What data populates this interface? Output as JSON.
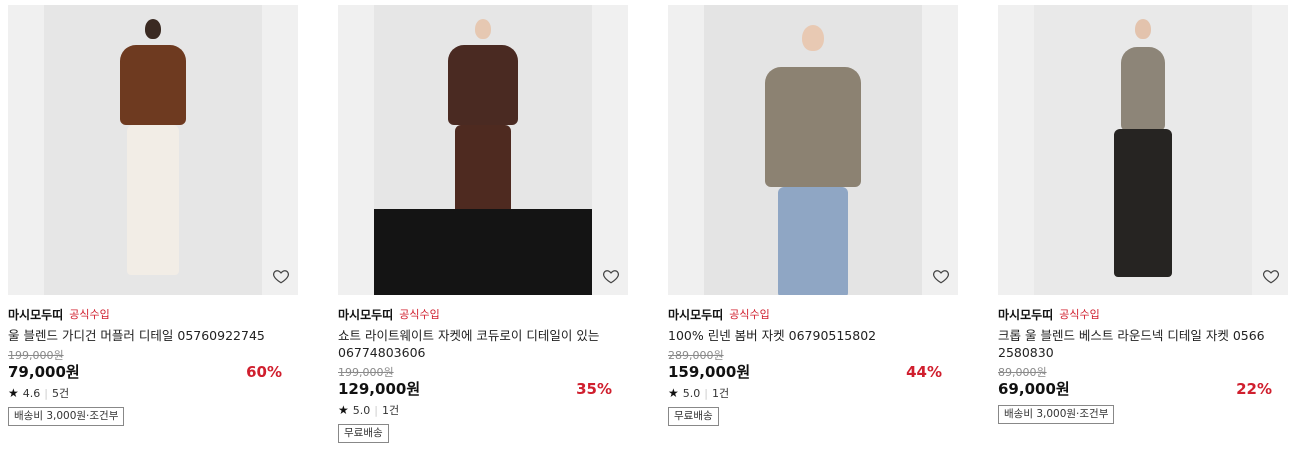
{
  "products": [
    {
      "brand": "마시모두띠",
      "badge": "공식수입",
      "title": "울 블렌드 가디건 머플러 디테일 05760922745",
      "original_price": "199,000원",
      "price": "79,000원",
      "discount": "60%",
      "rating": "4.6",
      "reviews": "5건",
      "shipping": "배송비 3,000원·조건부",
      "colors": {
        "bg": "#ebebeb",
        "top": "#6e3a20",
        "bottom": "#f2ede6",
        "skin": "#3a2a22"
      }
    },
    {
      "brand": "마시모두띠",
      "badge": "공식수입",
      "title": "쇼트 라이트웨이트 자켓에 코듀로이 디테일이 있는 06774803606",
      "original_price": "199,000원",
      "price": "129,000원",
      "discount": "35%",
      "rating": "5.0",
      "reviews": "1건",
      "shipping": "무료배송",
      "colors": {
        "bg": "#e6e6e6",
        "top": "#4a2a22",
        "bottom": "#4e2a20",
        "skin": "#e6c8b2"
      }
    },
    {
      "brand": "마시모두띠",
      "badge": "공식수입",
      "title": "100% 린넨 봄버 자켓 06790515802",
      "original_price": "289,000원",
      "price": "159,000원",
      "discount": "44%",
      "rating": "5.0",
      "reviews": "1건",
      "shipping": "무료배송",
      "colors": {
        "bg": "#e4e4e4",
        "top": "#8c8272",
        "bottom": "#8fa6c4",
        "skin": "#e8c9b3"
      }
    },
    {
      "brand": "마시모두띠",
      "badge": "공식수입",
      "title": "크롭 울 블렌드 베스트 라운드넥 디테일 자켓 0566 2580830",
      "original_price": "89,000원",
      "price": "69,000원",
      "discount": "22%",
      "shipping": "배송비 3,000원·조건부",
      "colors": {
        "bg": "#e9e9e9",
        "top": "#8d8578",
        "bottom": "#262422",
        "skin": "#e3c3ad"
      }
    }
  ]
}
